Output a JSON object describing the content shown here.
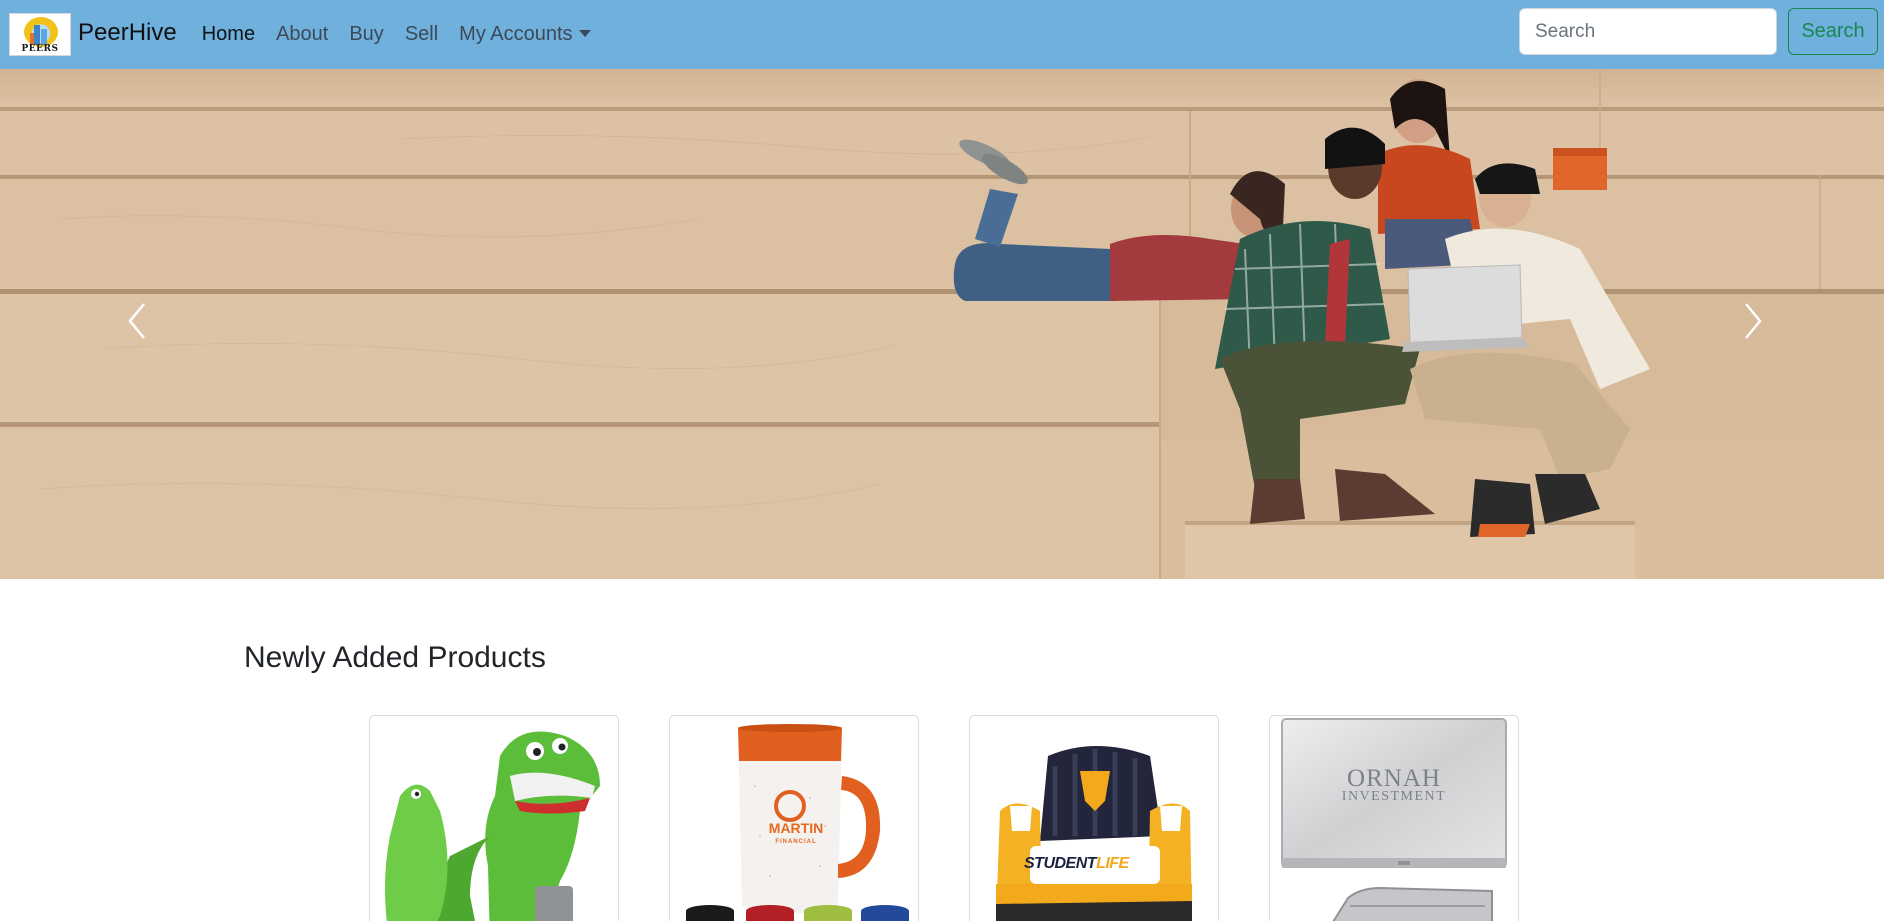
{
  "navbar": {
    "brand_name": "PeerHive",
    "logo_text": "PEERS",
    "links": [
      {
        "label": "Home",
        "active": true
      },
      {
        "label": "About"
      },
      {
        "label": "Buy"
      },
      {
        "label": "Sell"
      },
      {
        "label": "My Accounts",
        "dropdown": true
      }
    ],
    "search": {
      "placeholder": "Search",
      "button_label": "Search"
    },
    "background_color": "#6fb0dd"
  },
  "hero": {
    "image": "students-on-wooden-steps-photo",
    "prev_icon": "chevron-left-icon",
    "next_icon": "chevron-right-icon"
  },
  "products_section": {
    "title": "Newly Added Products",
    "products": [
      {
        "image": "green-alligator-stress-toy"
      },
      {
        "image": "orange-speckled-mug",
        "label_main": "MARTIN",
        "label_sub": "FINANCIAL"
      },
      {
        "image": "inflatable-student-chair",
        "label_a": "STUDENT",
        "label_b": "LIFE"
      },
      {
        "image": "silver-business-card-case",
        "label_line1": "ORNAH",
        "label_line2": "INVESTMENT"
      }
    ]
  }
}
